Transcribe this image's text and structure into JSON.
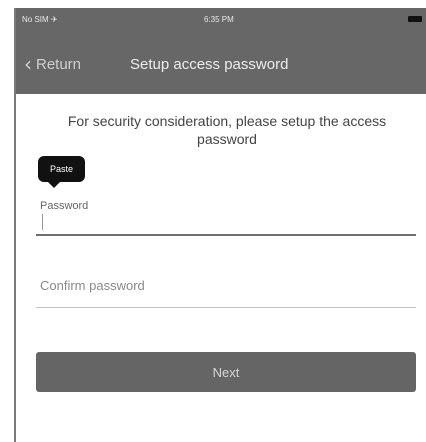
{
  "status_bar": {
    "carrier": "No SIM ✈",
    "time": "6:35 PM"
  },
  "nav": {
    "back_label": "Return",
    "title": "Setup access password"
  },
  "instruction": "For security consideration, please setup the access password",
  "tooltip": "Paste",
  "form": {
    "password_label": "Password",
    "confirm_placeholder": "Confirm password",
    "next_label": "Next"
  }
}
